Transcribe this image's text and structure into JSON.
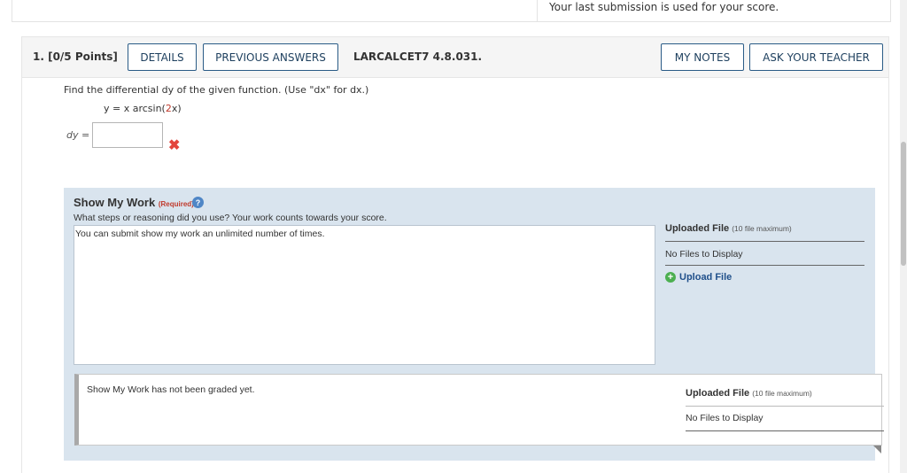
{
  "top": {
    "submission_note": "Your last submission is used for your score."
  },
  "question": {
    "number_points": "1.  [0/5 Points]",
    "code": "LARCALCET7 4.8.031.",
    "buttons": {
      "details": "DETAILS",
      "previous_answers": "PREVIOUS ANSWERS",
      "my_notes": "MY NOTES",
      "ask_teacher": "ASK YOUR TEACHER"
    },
    "prompt": "Find the differential dy of the given function. (Use \"dx\" for dx.)",
    "formula": {
      "prefix": "y = x arcsin(",
      "highlight": "2",
      "suffix": "x)"
    },
    "answer_label": "dy =",
    "answer_value": "",
    "answer_status_icon": "incorrect-x-icon"
  },
  "show_my_work": {
    "title": "Show My Work",
    "required": "(Required)",
    "help_icon": "?",
    "description": "What steps or reasoning did you use? Your work counts towards your score.",
    "textarea_text": "You can submit show my work an unlimited number of times.",
    "uploaded_title": "Uploaded File",
    "uploaded_max": "(10 file maximum)",
    "no_files": "No Files to Display",
    "upload_link": "Upload File",
    "graded_note": "Show My Work has not been graded yet.",
    "graded_uploaded_title": "Uploaded File",
    "graded_uploaded_max": "(10 file maximum)",
    "graded_no_files": "No Files to Display"
  },
  "colors": {
    "accent": "#2a5b86",
    "panel": "#d9e4ee",
    "error": "#e3443c",
    "link": "#1f4f8a"
  }
}
